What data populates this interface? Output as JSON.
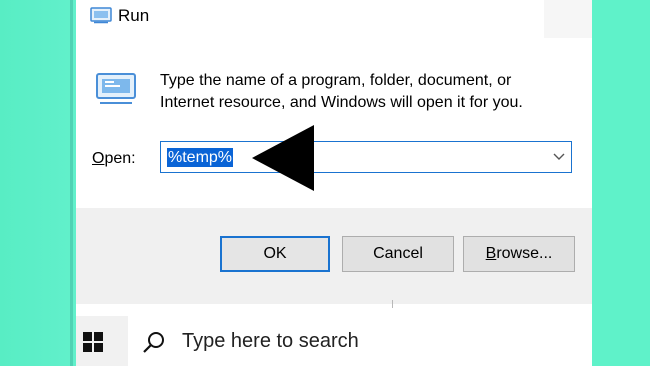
{
  "window": {
    "title": "Run",
    "icon": "run-icon"
  },
  "dialog": {
    "description_line1": "Type the name of a program, folder, document, or",
    "description_line2": "Internet resource, and Windows will open it for you.",
    "open_label_prefix": "O",
    "open_label_rest": "pen:",
    "open_value": "%temp%",
    "open_dropdown_icon": "chevron-down-icon"
  },
  "buttons": {
    "ok": "OK",
    "cancel": "Cancel",
    "browse_prefix": "B",
    "browse_rest": "rowse..."
  },
  "annotation": {
    "icon": "arrow-left-icon",
    "color": "#000000"
  },
  "taskbar": {
    "start_icon": "windows-logo-icon",
    "search_icon": "search-icon",
    "search_placeholder": "Type here to search"
  },
  "colors": {
    "background": "#5ff1c8",
    "accent": "#1a73d0",
    "selection": "#0a64d6"
  }
}
